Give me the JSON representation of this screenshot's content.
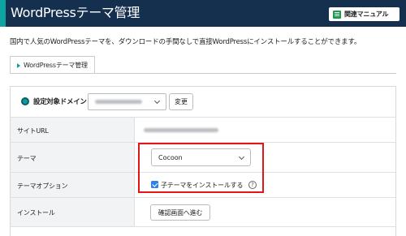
{
  "header": {
    "title": "WordPressテーマ管理",
    "manual_label": "関連マニュアル"
  },
  "description": "国内で人気のWordPressテーマを、ダウンロードの手間なしで直接WordPressにインストールすることができます。",
  "tab": {
    "label": "WordPressテーマ管理"
  },
  "domain": {
    "label": "設定対象ドメイン",
    "change_label": "変更"
  },
  "rows": {
    "site_url_label": "サイトURL",
    "theme_label": "テーマ",
    "theme_value": "Cocoon",
    "option_label": "テーマオプション",
    "option_checkbox_label": "子テーマをインストールする",
    "option_checked": true,
    "install_label": "インストール",
    "install_button": "確認画面へ進む"
  },
  "colors": {
    "header_bg": "#15304f",
    "accent": "#0ea4a2",
    "highlight": "#e0161b",
    "checkbox": "#2f80ed"
  },
  "icons": {
    "manual": "book-icon",
    "tab": "triangle-right-icon",
    "help": "question-circle-icon",
    "select": "chevron-down-icon"
  }
}
